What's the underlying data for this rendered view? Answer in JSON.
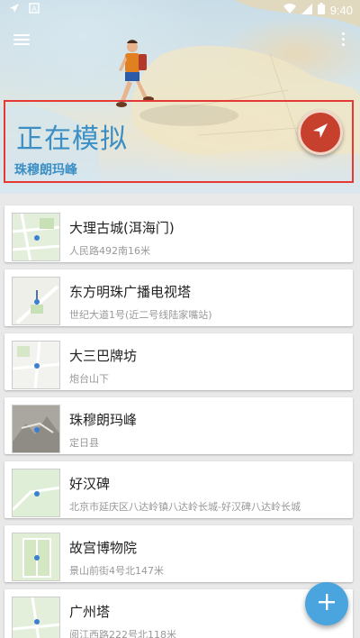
{
  "status_bar": {
    "time": "9:40",
    "icons": [
      "navigation-icon",
      "sim-a-icon",
      "wifi-icon",
      "signal-icon",
      "battery-icon"
    ]
  },
  "toolbar": {
    "menu_icon": "menu-icon",
    "more_icon": "more-vert-icon"
  },
  "simulation": {
    "title": "正在模拟",
    "location": "珠穆朗玛峰",
    "button_icon": "navigate-arrow-icon"
  },
  "places": [
    {
      "name": "大理古城(洱海门)",
      "address": "人民路492南16米",
      "thumb": "map-thumb-green"
    },
    {
      "name": "东方明珠广播电视塔",
      "address": "世纪大道1号(近二号线陆家嘴站)",
      "thumb": "map-thumb-gray"
    },
    {
      "name": "大三巴牌坊",
      "address": "炮台山下",
      "thumb": "map-thumb-light"
    },
    {
      "name": "珠穆朗玛峰",
      "address": "定日县",
      "thumb": "map-thumb-terrain"
    },
    {
      "name": "好汉碑",
      "address": "北京市延庆区八达岭镇八达岭长城-好汉碑八达岭长城",
      "thumb": "map-thumb-green"
    },
    {
      "name": "故宫博物院",
      "address": "景山前街4号北147米",
      "thumb": "map-thumb-green"
    },
    {
      "name": "广州塔",
      "address": "阅江西路222号北118米",
      "thumb": "map-thumb-green"
    }
  ],
  "fab": {
    "icon": "add-icon"
  },
  "colors": {
    "accent": "#4aa4de",
    "title_blue": "#3c8fc4",
    "highlight_red": "#e53935",
    "sim_button": "#c7402e"
  }
}
